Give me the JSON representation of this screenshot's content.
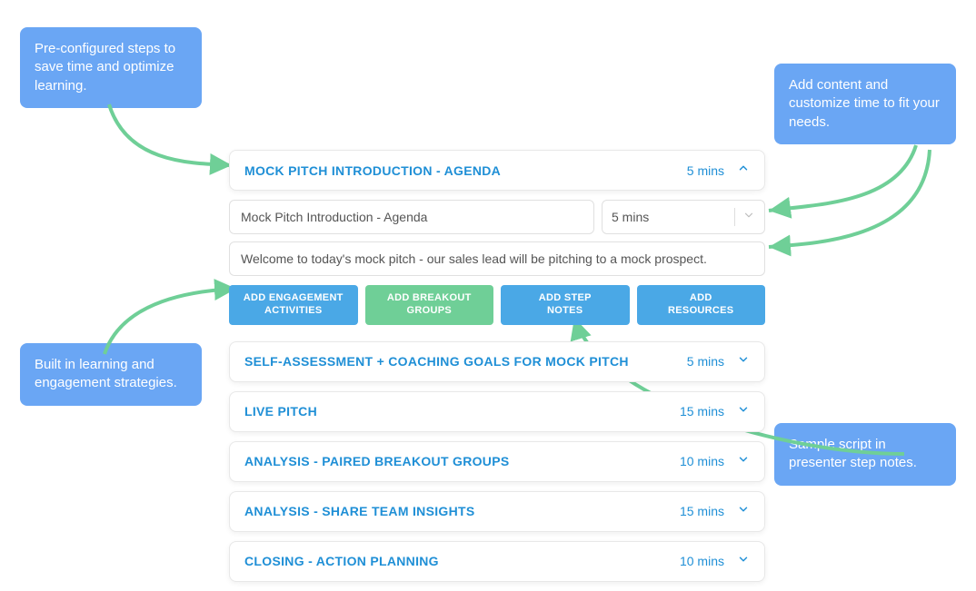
{
  "callouts": {
    "top_left": "Pre-configured steps to save time and optimize learning.",
    "top_right": "Add content and customize time to fit your needs.",
    "bottom_left": "Built in learning and engagement strategies.",
    "bottom_right": "Sample script in presenter step notes."
  },
  "expanded_step": {
    "title": "MOCK PITCH INTRODUCTION - AGENDA",
    "duration": "5 mins",
    "title_input": "Mock Pitch Introduction - Agenda",
    "duration_input": "5 mins",
    "description": "Welcome to today's mock pitch - our sales lead will be pitching to a mock prospect."
  },
  "actions": {
    "engagement": "ADD ENGAGEMENT\nACTIVITIES",
    "breakout": "ADD BREAKOUT\nGROUPS",
    "notes": "ADD STEP\nNOTES",
    "resources": "ADD\nRESOURCES"
  },
  "steps": [
    {
      "title": "SELF-ASSESSMENT + COACHING GOALS FOR MOCK PITCH",
      "duration": "5 mins"
    },
    {
      "title": "LIVE PITCH",
      "duration": "15 mins"
    },
    {
      "title": "ANALYSIS - PAIRED BREAKOUT GROUPS",
      "duration": "10 mins"
    },
    {
      "title": "ANALYSIS - SHARE TEAM INSIGHTS",
      "duration": "15 mins"
    },
    {
      "title": "CLOSING - ACTION PLANNING",
      "duration": "10 mins"
    }
  ]
}
